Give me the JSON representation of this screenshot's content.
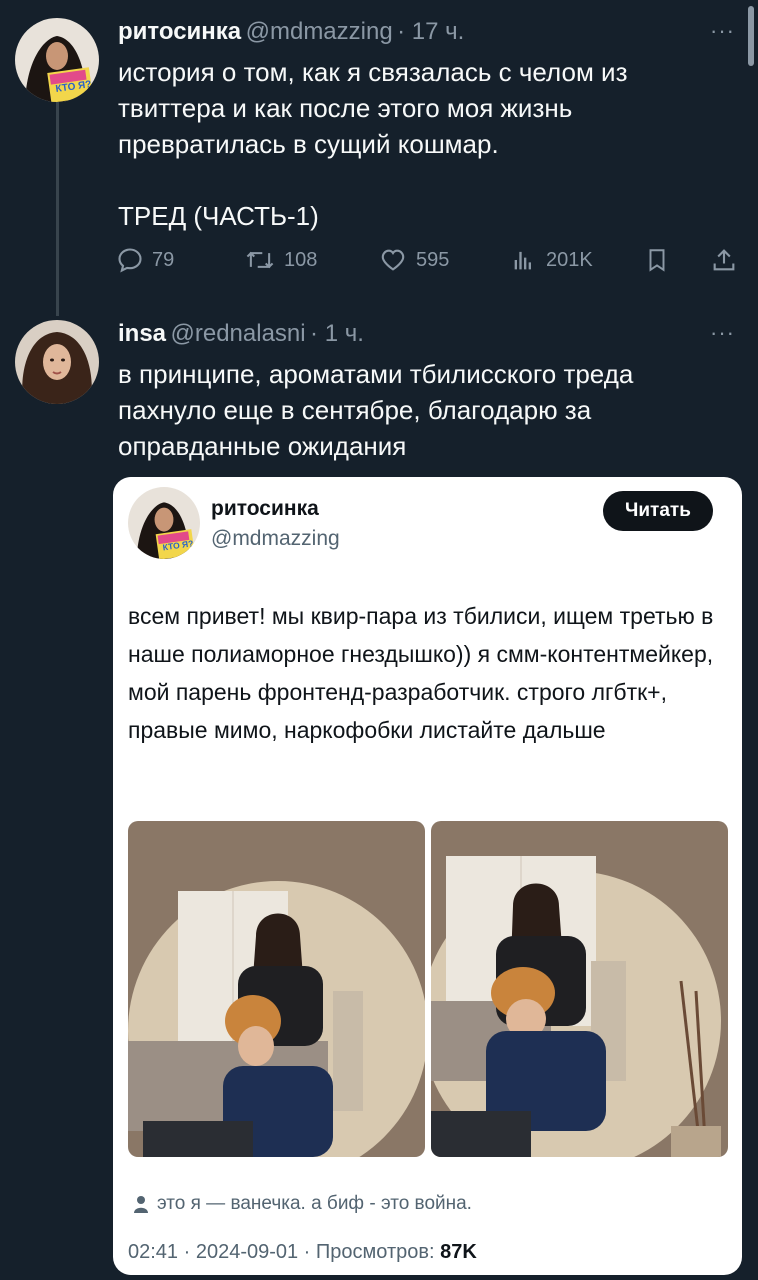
{
  "tweet1": {
    "author": "ритосинка",
    "handle": "@mdmazzing",
    "time": "· 17 ч.",
    "text": "история о том, как я связалась с челом из твиттера и как после этого моя жизнь превратилась в сущий кошмар.\n\nТРЕД (ЧАСТЬ-1)",
    "replies": "79",
    "retweets": "108",
    "likes": "595",
    "views": "201K",
    "avatar_text": "КТО Я?"
  },
  "tweet2": {
    "author": "insa",
    "handle": "@rednalasni",
    "time": "· 1 ч.",
    "text": "в принципе, ароматами тбилисского треда пахнуло еще в сентябре, благодарю за оправданные ожидания"
  },
  "quoted": {
    "author": "ритосинка",
    "handle": "@mdmazzing",
    "follow_label": "Читать",
    "text": "всем привет! мы квир-пара из тбилиси, ищем третью в наше полиаморное гнездышко)) я смм-контентмейкер, мой парень фронтенд-разработчик. строго лгбтк+, правые мимо, наркофобки листайте дальше",
    "caption": "это я — ванечка. а биф - это война.",
    "datetime": "02:41 · 2024-09-01 · ",
    "views_label": "Просмотров: ",
    "views_value": "87K",
    "avatar_text": "КТО Я?"
  },
  "icons": [
    "more-icon",
    "reply-icon",
    "retweet-icon",
    "like-icon",
    "views-icon",
    "bookmark-icon",
    "share-icon",
    "person-icon"
  ],
  "colors": {
    "background": "#15202b",
    "secondary": "#8b98a5",
    "text": "#f7f9f9"
  }
}
